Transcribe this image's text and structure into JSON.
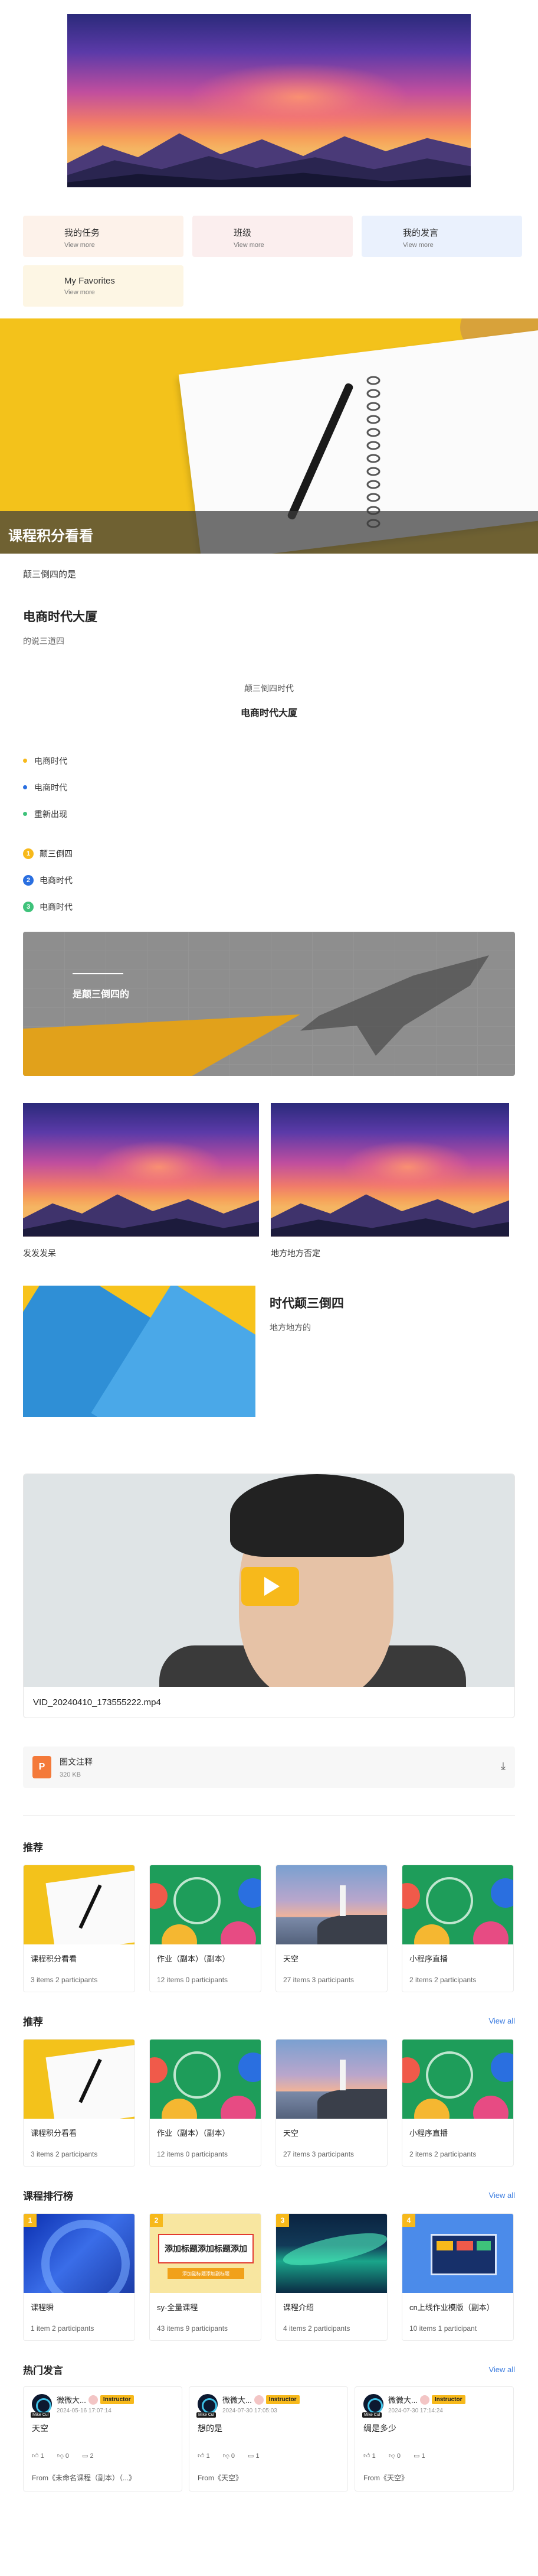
{
  "quick_links": [
    {
      "title": "我的任务",
      "sub": "View more"
    },
    {
      "title": "班级",
      "sub": "View more"
    },
    {
      "title": "我的发言",
      "sub": "View more"
    },
    {
      "title": "My Favorites",
      "sub": "View more"
    }
  ],
  "banner": {
    "caption": "课程积分看看"
  },
  "text_blocks": {
    "line1": "颠三倒四的是",
    "heading": "电商时代大厦",
    "sub": "的说三道四",
    "center_small": "颠三倒四时代",
    "center_big": "电商时代大厦"
  },
  "bullets": [
    {
      "text": "电商时代",
      "color": "#f7b91b"
    },
    {
      "text": "电商时代",
      "color": "#2a6fe0"
    },
    {
      "text": "重新出现",
      "color": "#3ec27a"
    }
  ],
  "ordered": [
    {
      "num": "1",
      "text": "颠三倒四",
      "color": "#f7b91b"
    },
    {
      "num": "2",
      "text": "电商时代",
      "color": "#2a6fe0"
    },
    {
      "num": "3",
      "text": "电商时代",
      "color": "#3ec27a"
    }
  ],
  "plane_block": {
    "label": "是颠三倒四的"
  },
  "two_images": [
    {
      "caption": "发发发呆"
    },
    {
      "caption": "地方地方否定"
    }
  ],
  "image_text": {
    "title": "时代颠三倒四",
    "sub": "地方地方的"
  },
  "video": {
    "filename": "VID_20240410_173555222.mp4"
  },
  "file": {
    "icon": "P",
    "name": "图文注释",
    "size": "320 KB"
  },
  "recommend1": {
    "title": "推荐",
    "cards": [
      {
        "title": "课程积分看看",
        "meta": "3 items  2 participants",
        "img": "notebook"
      },
      {
        "title": "作业（副本）（副本）",
        "meta": "12 items  0 participants",
        "img": "green"
      },
      {
        "title": "天空",
        "meta": "27 items  3 participants",
        "img": "sea"
      },
      {
        "title": "小程序直播",
        "meta": "2 items  2 participants",
        "img": "green"
      }
    ]
  },
  "recommend2": {
    "title": "推荐",
    "view_all": "View all",
    "cards": [
      {
        "title": "课程积分看看",
        "meta": "3 items  2 participants",
        "img": "notebook"
      },
      {
        "title": "作业（副本）（副本）",
        "meta": "12 items  0 participants",
        "img": "green"
      },
      {
        "title": "天空",
        "meta": "27 items  3 participants",
        "img": "sea"
      },
      {
        "title": "小程序直播",
        "meta": "2 items  2 participants",
        "img": "green"
      }
    ]
  },
  "ranking": {
    "title": "课程排行榜",
    "view_all": "View all",
    "cards": [
      {
        "rank": "1",
        "title": "课程瞬",
        "meta": "1 item  2 participants",
        "img": "blue"
      },
      {
        "rank": "2",
        "title": "sy-全量课程",
        "meta": "43 items  9 participants",
        "img": "poster",
        "poster_text": "添加标题添加标题添加",
        "poster_sub": "添加副标题添加副标题"
      },
      {
        "rank": "3",
        "title": "课程介绍",
        "meta": "4 items  2 participants",
        "img": "aurora"
      },
      {
        "rank": "4",
        "title": "cn上线作业模版（副本）",
        "meta": "10 items  1 participant",
        "img": "bluetile"
      }
    ]
  },
  "hot_posts": {
    "title": "热门发言",
    "view_all": "View all",
    "posts": [
      {
        "name": "微微大...",
        "badge": "Instructor",
        "time": "2024-05-16 17:07:14",
        "body": "天空",
        "likes": "1",
        "dislikes": "0",
        "comments": "2",
        "from": "From《未命名课程（副本）（...》",
        "avatar_tag": "Mike Cul"
      },
      {
        "name": "微微大...",
        "badge": "Instructor",
        "time": "2024-07-30 17:05:03",
        "body": "想的是",
        "likes": "1",
        "dislikes": "0",
        "comments": "1",
        "from": "From《天空》",
        "avatar_tag": "Mike Cul"
      },
      {
        "name": "微微大...",
        "badge": "Instructor",
        "time": "2024-07-30 17:14:24",
        "body": "绸是多少",
        "likes": "1",
        "dislikes": "0",
        "comments": "1",
        "from": "From《天空》",
        "avatar_tag": "Mike Cul"
      }
    ]
  }
}
